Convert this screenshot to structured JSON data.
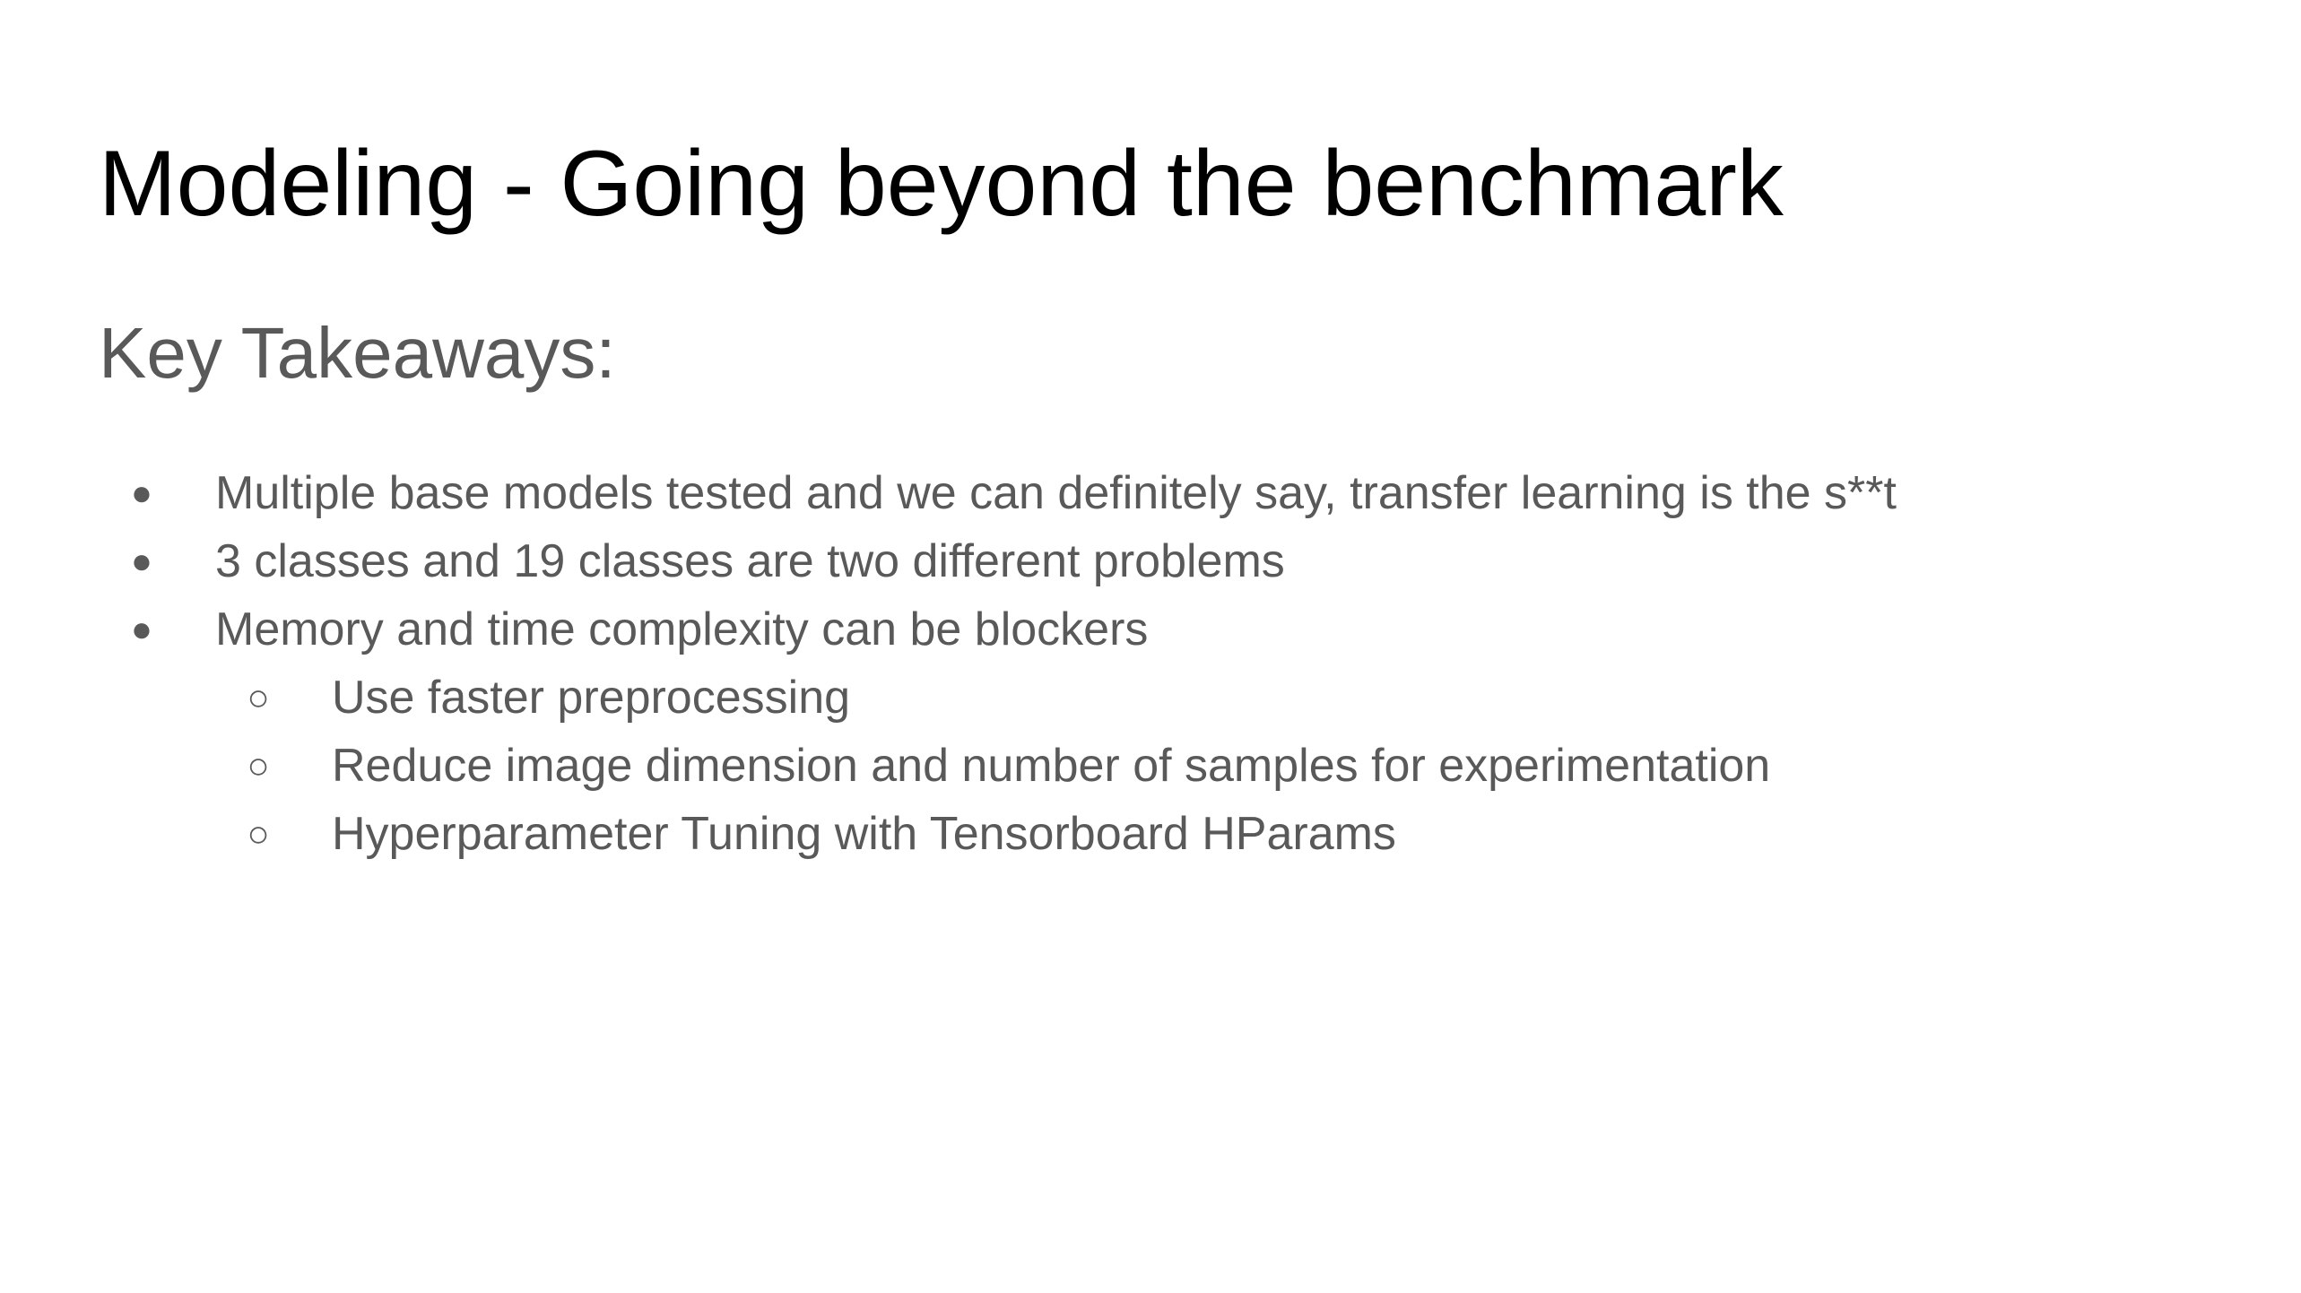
{
  "slide": {
    "title": "Modeling - Going beyond the benchmark",
    "subtitle": "Key Takeaways:",
    "bullets": [
      {
        "marker": "●",
        "text": "Multiple base models tested and we can definitely say, transfer learning is the s**t",
        "level": 1
      },
      {
        "marker": "●",
        "text": "3 classes and 19 classes are two different problems",
        "level": 1
      },
      {
        "marker": "●",
        "text": "Memory and time complexity can be blockers",
        "level": 1
      },
      {
        "marker": "○",
        "text": "Use faster preprocessing",
        "level": 2
      },
      {
        "marker": "○",
        "text": "Reduce image dimension and number of samples for experimentation",
        "level": 2
      },
      {
        "marker": "○",
        "text": "Hyperparameter Tuning with Tensorboard HParams",
        "level": 2
      }
    ]
  },
  "colors": {
    "background": "#ffffff",
    "title": "#000000",
    "body_text": "#595959"
  }
}
